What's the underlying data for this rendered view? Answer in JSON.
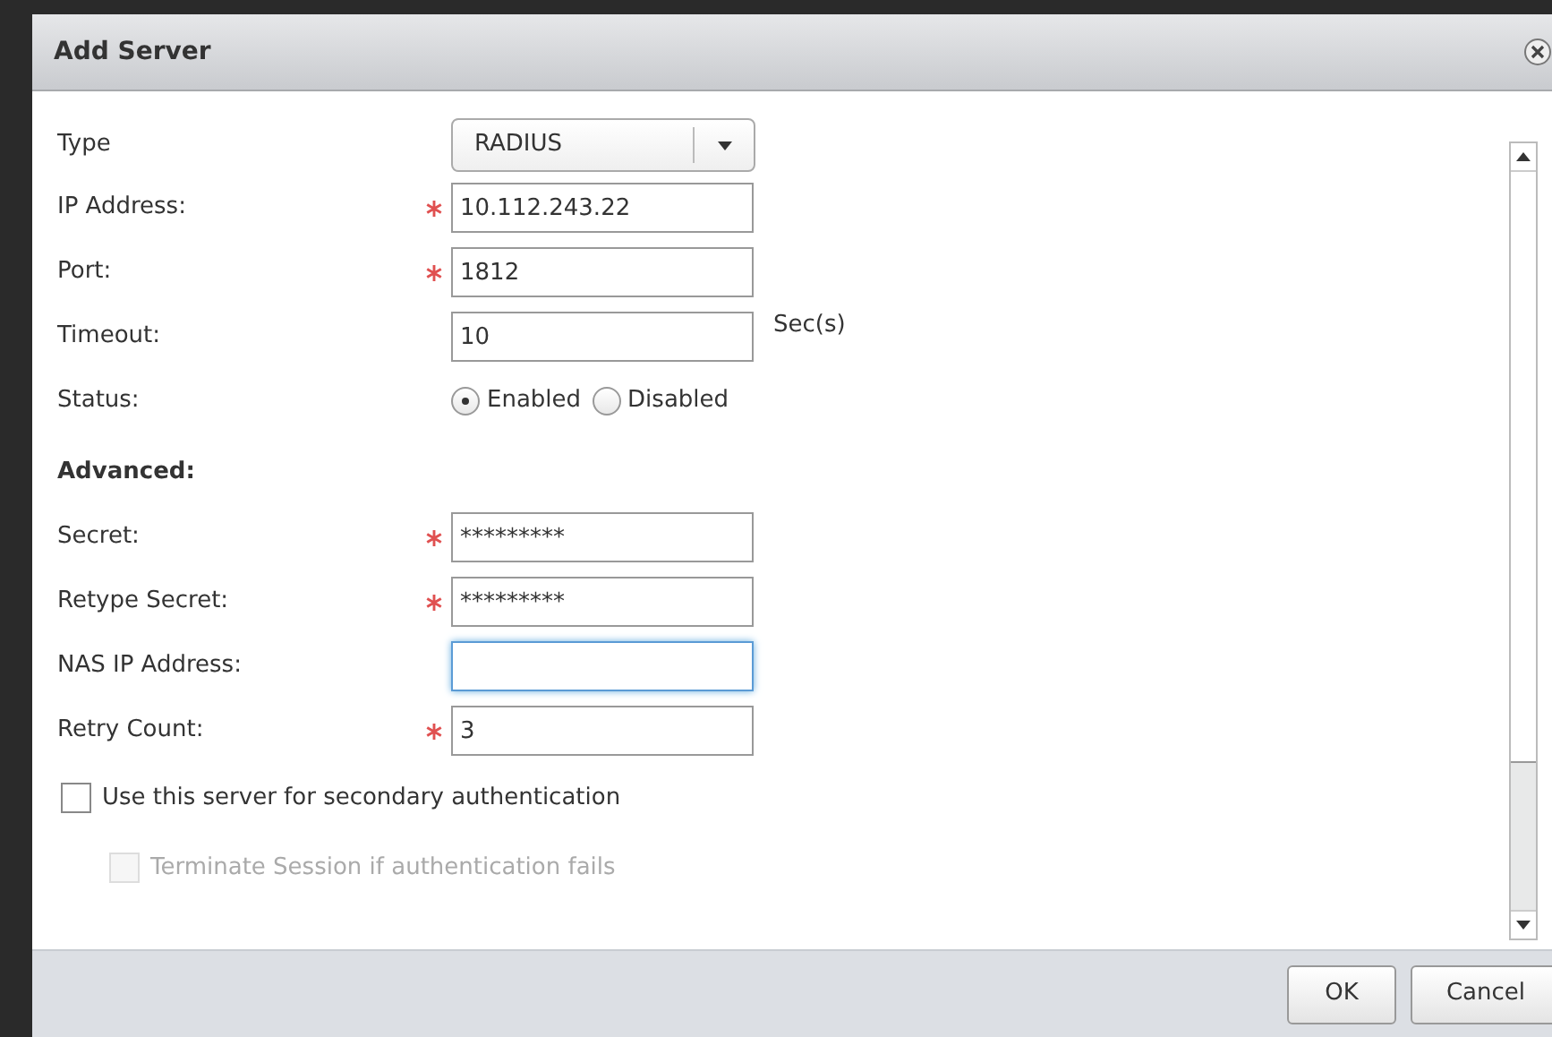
{
  "dialog": {
    "title": "Add Server"
  },
  "form": [
    {
      "kind": "select",
      "label": "Type",
      "value": "RADIUS"
    },
    {
      "kind": "text",
      "label": "IP Address:",
      "required": true,
      "value": "10.112.243.22",
      "focused": false
    },
    {
      "kind": "text",
      "label": "Port:",
      "required": true,
      "value": "1812",
      "focused": false
    },
    {
      "kind": "text",
      "label": "Timeout:",
      "required": false,
      "value": "10",
      "focused": false,
      "unit": "Sec(s)"
    },
    {
      "kind": "radio",
      "label": "Status:",
      "options": [
        {
          "label": "Enabled",
          "selected": true
        },
        {
          "label": "Disabled",
          "selected": false
        }
      ]
    },
    {
      "kind": "heading",
      "label": "Advanced:"
    },
    {
      "kind": "text",
      "label": "Secret:",
      "required": true,
      "value": "*********",
      "focused": false
    },
    {
      "kind": "text",
      "label": "Retype Secret:",
      "required": true,
      "value": "*********",
      "focused": false
    },
    {
      "kind": "text",
      "label": "NAS IP Address:",
      "required": false,
      "focused": true
    },
    {
      "kind": "text",
      "label": "Retry Count:",
      "required": true,
      "value": "3",
      "focused": false
    },
    {
      "kind": "checkbox",
      "label": "Use this server for secondary authentication",
      "checked": false,
      "disabled": false,
      "nested": false
    },
    {
      "kind": "checkbox",
      "label": "Terminate Session if authentication fails",
      "checked": false,
      "disabled": true,
      "nested": true
    }
  ],
  "buttons": [
    "OK",
    "Cancel"
  ]
}
